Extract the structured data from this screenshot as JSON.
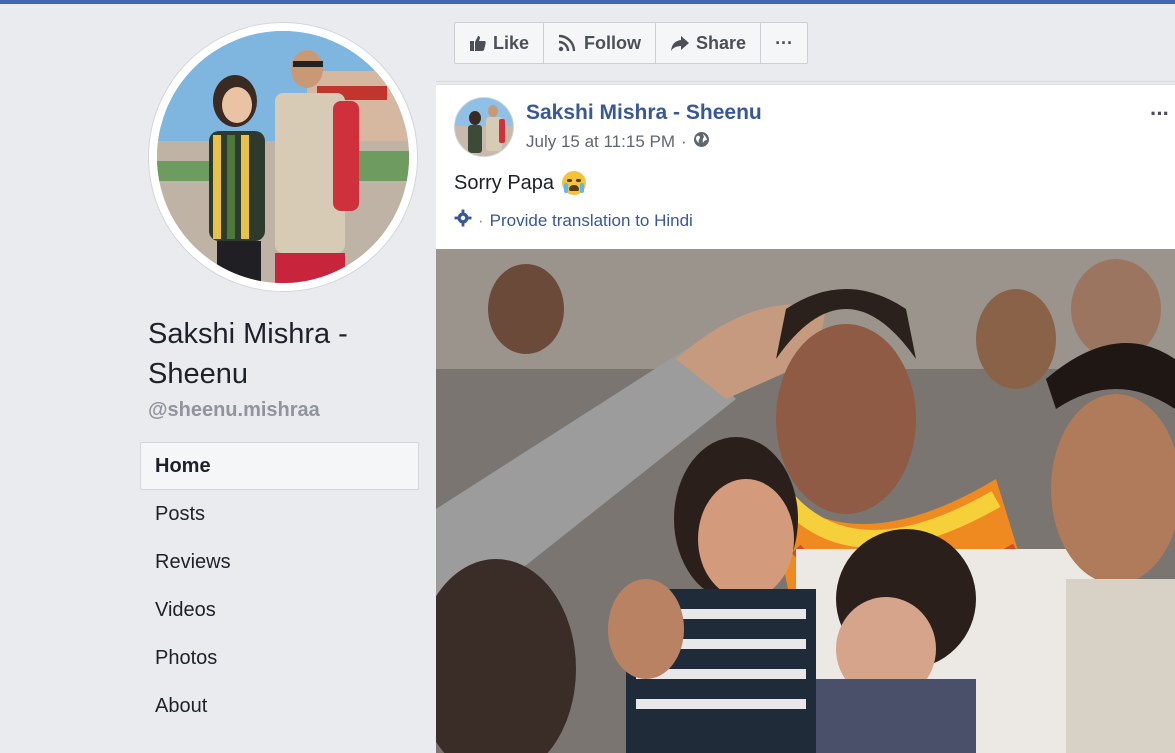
{
  "page": {
    "name": "Sakshi Mishra - Sheenu",
    "handle": "@sheenu.mishraa"
  },
  "nav": {
    "items": [
      "Home",
      "Posts",
      "Reviews",
      "Videos",
      "Photos",
      "About"
    ]
  },
  "actions": {
    "like": "Like",
    "follow": "Follow",
    "share": "Share",
    "more": "···"
  },
  "post": {
    "author": "Sakshi Mishra - Sheenu",
    "timestamp": "July 15 at 11:15 PM",
    "separator": "·",
    "text": "Sorry Papa",
    "translate": "Provide translation to Hindi",
    "more": "···"
  },
  "colors": {
    "brand_blue": "#4267b2",
    "link_blue": "#385898",
    "background": "#e9ebee"
  },
  "icons": {
    "like": "thumbs-up-icon",
    "follow": "rss-icon",
    "share": "share-arrow-icon",
    "globe": "globe-icon",
    "gear": "gear-icon",
    "emoji": "crying-face-icon"
  }
}
